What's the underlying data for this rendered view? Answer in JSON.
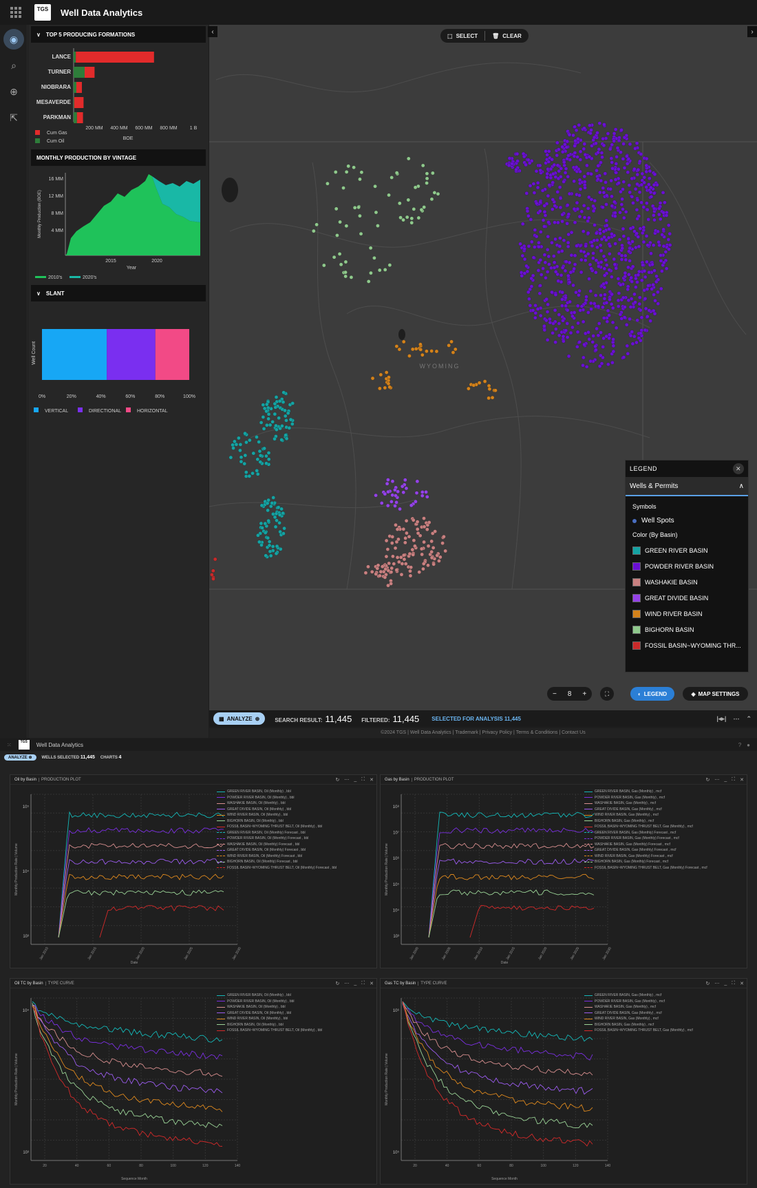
{
  "app": {
    "title": "Well Data Analytics",
    "logo_text": "TGS"
  },
  "rail": {
    "items": [
      "home",
      "search",
      "zoom-search",
      "export"
    ]
  },
  "panel": {
    "formations": {
      "title": "TOP 5 PRODUCING FORMATIONS",
      "chart_data": {
        "type": "bar",
        "categories": [
          "LANCE",
          "TURNER",
          "NIOBRARA",
          "MESAVERDE",
          "PARKMAN"
        ],
        "series": [
          {
            "name": "Cum Oil",
            "values": [
              20,
              100,
              25,
              5,
              30
            ]
          },
          {
            "name": "Cum Gas",
            "values": [
              710,
              90,
              50,
              85,
              55
            ]
          }
        ],
        "xlabel": "BOE",
        "tick_labels": [
          "200 MM",
          "400 MM",
          "600 MM",
          "800 MM",
          "1 B"
        ],
        "xlim": [
          0,
          1000
        ],
        "colors": {
          "Cum Gas": "#e22b2b",
          "Cum Oil": "#2e7d3a"
        }
      },
      "legend": [
        "Cum Gas",
        "Cum Oil"
      ]
    },
    "vintage": {
      "title": "MONTHLY PRODUCTION BY VINTAGE",
      "chart_data": {
        "type": "area",
        "ylabel": "Monthly Production (BOE)",
        "xlabel": "Year",
        "y_tick_labels": [
          "16 MM",
          "12 MM",
          "8 MM",
          "4 MM"
        ],
        "x_tick_labels": [
          "2015",
          "2020"
        ],
        "ylim": [
          0,
          18
        ],
        "series": [
          {
            "name": "2010's",
            "color": "#1fc25a"
          },
          {
            "name": "2020's",
            "color": "#19b8a6"
          }
        ]
      },
      "legend": [
        "2010's",
        "2020's"
      ]
    },
    "slant": {
      "title": "SLANT",
      "chart_data": {
        "type": "bar",
        "ylabel": "Well Count",
        "x_tick_labels": [
          "0%",
          "20%",
          "40%",
          "60%",
          "80%",
          "100%"
        ],
        "series": [
          {
            "name": "VERTICAL",
            "values": [
              44
            ],
            "color": "#17a7f5"
          },
          {
            "name": "DIRECTIONAL",
            "values": [
              33
            ],
            "color": "#7a2ff0"
          },
          {
            "name": "HORIZONTAL",
            "values": [
              23
            ],
            "color": "#f24a86"
          }
        ]
      },
      "legend": [
        "VERTICAL",
        "DIRECTIONAL",
        "HORIZONTAL"
      ]
    }
  },
  "map": {
    "toolbar": {
      "select": "SELECT",
      "clear": "CLEAR"
    },
    "state_label": "WYOMING",
    "zoom_level": "8",
    "legend": {
      "title": "LEGEND",
      "section": "Wells & Permits",
      "symbols_title": "Symbols",
      "symbol": "Well Spots",
      "color_title": "Color (By Basin)",
      "items": [
        {
          "label": "GREEN RIVER BASIN",
          "color": "#14a3a3"
        },
        {
          "label": "POWDER RIVER BASIN",
          "color": "#6a0fd4"
        },
        {
          "label": "WASHAKIE BASIN",
          "color": "#c98080"
        },
        {
          "label": "GREAT DIVIDE BASIN",
          "color": "#9442e8"
        },
        {
          "label": "WIND RIVER BASIN",
          "color": "#d4821a"
        },
        {
          "label": "BIGHORN BASIN",
          "color": "#8fc98c"
        },
        {
          "label": "FOSSIL BASIN~WYOMING THR...",
          "color": "#c92a2a"
        }
      ]
    },
    "buttons": {
      "legend": "LEGEND",
      "map_settings": "MAP SETTINGS"
    }
  },
  "status": {
    "analyze": "ANALYZE",
    "search_label": "SEARCH RESULT:",
    "search_value": "11,445",
    "filtered_label": "FILTERED:",
    "filtered_value": "11,445",
    "selected": "SELECTED FOR ANALYSIS 11,445"
  },
  "footer": "©2024 TGS | Well Data Analytics | Trademark | Privacy Policy | Terms & Conditions | Contact Us",
  "bottom": {
    "title": "Well Data Analytics",
    "analyze": "ANALYZE",
    "wells_selected_label": "WELLS SELECTED",
    "wells_selected": "11,445",
    "charts_label": "CHARTS",
    "charts": "4",
    "panels": [
      {
        "title": "Oil by Basin",
        "subtitle": "PRODUCTION PLOT",
        "xlabel": "Date",
        "ylabel": "Monthly Production Rate | Volume",
        "x_ticks": [
          "Jan 2010",
          "Jan 2015",
          "Jan 2020",
          "Jan 2025",
          "Jan 2030"
        ],
        "y_ticks": [
          "10⁵",
          "10⁴",
          "10³"
        ],
        "legend": [
          {
            "t": "GREEN RIVER BASIN, Oil (Monthly) , bbl",
            "c": "#14b8b8",
            "d": false
          },
          {
            "t": "POWDER RIVER BASIN, Oil (Monthly) , bbl",
            "c": "#7a2fe0",
            "d": false
          },
          {
            "t": "WASHAKIE BASIN, Oil (Monthly) , bbl",
            "c": "#d88f8f",
            "d": false
          },
          {
            "t": "GREAT DIVIDE BASIN, Oil (Monthly) , bbl",
            "c": "#9c5cf0",
            "d": false
          },
          {
            "t": "WIND RIVER BASIN, Oil (Monthly) , bbl",
            "c": "#e08a1e",
            "d": false
          },
          {
            "t": "BIGHORN BASIN, Oil (Monthly) , bbl",
            "c": "#9bd497",
            "d": false
          },
          {
            "t": "FOSSIL BASIN~WYOMING THRUST BELT, Oil (Monthly) , bbl",
            "c": "#d42a2a",
            "d": false
          },
          {
            "t": "GREEN RIVER BASIN, Oil (Monthly) Forecast , bbl",
            "c": "#14b8b8",
            "d": true
          },
          {
            "t": "POWDER RIVER BASIN, Oil (Monthly) Forecast , bbl",
            "c": "#7a2fe0",
            "d": true
          },
          {
            "t": "WASHAKIE BASIN, Oil (Monthly) Forecast , bbl",
            "c": "#d88f8f",
            "d": true
          },
          {
            "t": "GREAT DIVIDE BASIN, Oil (Monthly) Forecast , bbl",
            "c": "#9c5cf0",
            "d": true
          },
          {
            "t": "WIND RIVER BASIN, Oil (Monthly) Forecast , bbl",
            "c": "#e08a1e",
            "d": true
          },
          {
            "t": "BIGHORN BASIN, Oil (Monthly) Forecast , bbl",
            "c": "#9bd497",
            "d": true
          },
          {
            "t": "FOSSIL BASIN~WYOMING THRUST BELT, Oil (Monthly) Forecast , bbl",
            "c": "#d42a2a",
            "d": true
          }
        ]
      },
      {
        "title": "Gas by Basin",
        "subtitle": "PRODUCTION PLOT",
        "xlabel": "Date",
        "ylabel": "Monthly Production Rate | Volume",
        "x_ticks": [
          "Jan 2000",
          "Jan 2005",
          "Jan 2010",
          "Jan 2015",
          "Jan 2020",
          "Jan 2025",
          "Jan 2030"
        ],
        "y_ticks": [
          "10⁸",
          "10⁷",
          "10⁶",
          "10⁵",
          "10⁴",
          "10³"
        ],
        "legend": [
          {
            "t": "GREEN RIVER BASIN, Gas (Monthly) , mcf",
            "c": "#14b8b8",
            "d": false
          },
          {
            "t": "POWDER RIVER BASIN, Gas (Monthly) , mcf",
            "c": "#7a2fe0",
            "d": false
          },
          {
            "t": "WASHAKIE BASIN, Gas (Monthly) , mcf",
            "c": "#d88f8f",
            "d": false
          },
          {
            "t": "GREAT DIVIDE BASIN, Gas (Monthly) , mcf",
            "c": "#9c5cf0",
            "d": false
          },
          {
            "t": "WIND RIVER BASIN, Gas (Monthly) , mcf",
            "c": "#e08a1e",
            "d": false
          },
          {
            "t": "BIGHORN BASIN, Gas (Monthly) , mcf",
            "c": "#9bd497",
            "d": false
          },
          {
            "t": "FOSSIL BASIN~WYOMING THRUST BELT, Gas (Monthly) , mcf",
            "c": "#d42a2a",
            "d": false
          },
          {
            "t": "GREEN RIVER BASIN, Gas (Monthly) Forecast , mcf",
            "c": "#14b8b8",
            "d": true
          },
          {
            "t": "POWDER RIVER BASIN, Gas (Monthly) Forecast , mcf",
            "c": "#7a2fe0",
            "d": true
          },
          {
            "t": "WASHAKIE BASIN, Gas (Monthly) Forecast , mcf",
            "c": "#d88f8f",
            "d": true
          },
          {
            "t": "GREAT DIVIDE BASIN, Gas (Monthly) Forecast , mcf",
            "c": "#9c5cf0",
            "d": true
          },
          {
            "t": "WIND RIVER BASIN, Gas (Monthly) Forecast , mcf",
            "c": "#e08a1e",
            "d": true
          },
          {
            "t": "BIGHORN BASIN, Gas (Monthly) Forecast , mcf",
            "c": "#9bd497",
            "d": true
          },
          {
            "t": "FOSSIL BASIN~WYOMING THRUST BELT, Gas (Monthly) Forecast , mcf",
            "c": "#d42a2a",
            "d": true
          }
        ]
      },
      {
        "title": "Oil TC by Basin",
        "subtitle": "TYPE CURVE",
        "xlabel": "Sequence Month",
        "ylabel": "Monthly Production Rate | Volume",
        "x_ticks": [
          "20",
          "40",
          "60",
          "80",
          "100",
          "120",
          "140"
        ],
        "y_ticks": [
          "10⁴",
          "10³"
        ],
        "legend": [
          {
            "t": "GREEN RIVER BASIN, Oil (Monthly) , bbl",
            "c": "#14b8b8",
            "d": false
          },
          {
            "t": "POWDER RIVER BASIN, Oil (Monthly) , bbl",
            "c": "#7a2fe0",
            "d": false
          },
          {
            "t": "WASHAKIE BASIN, Oil (Monthly) , bbl",
            "c": "#d88f8f",
            "d": false
          },
          {
            "t": "GREAT DIVIDE BASIN, Oil (Monthly) , bbl",
            "c": "#9c5cf0",
            "d": false
          },
          {
            "t": "WIND RIVER BASIN, Oil (Monthly) , bbl",
            "c": "#e08a1e",
            "d": false
          },
          {
            "t": "BIGHORN BASIN, Oil (Monthly) , bbl",
            "c": "#9bd497",
            "d": false
          },
          {
            "t": "FOSSIL BASIN~WYOMING THRUST BELT, Oil (Monthly) , bbl",
            "c": "#d42a2a",
            "d": false
          }
        ]
      },
      {
        "title": "Gas TC by Basin",
        "subtitle": "TYPE CURVE",
        "xlabel": "Sequence Month",
        "ylabel": "Monthly Production Rate | Volume",
        "x_ticks": [
          "20",
          "40",
          "60",
          "80",
          "100",
          "120",
          "140"
        ],
        "y_ticks": [
          "10⁶",
          "10⁵"
        ],
        "legend": [
          {
            "t": "GREEN RIVER BASIN, Gas (Monthly) , mcf",
            "c": "#14b8b8",
            "d": false
          },
          {
            "t": "POWDER RIVER BASIN, Gas (Monthly) , mcf",
            "c": "#7a2fe0",
            "d": false
          },
          {
            "t": "WASHAKIE BASIN, Gas (Monthly) , mcf",
            "c": "#d88f8f",
            "d": false
          },
          {
            "t": "GREAT DIVIDE BASIN, Gas (Monthly) , mcf",
            "c": "#9c5cf0",
            "d": false
          },
          {
            "t": "WIND RIVER BASIN, Gas (Monthly) , mcf",
            "c": "#e08a1e",
            "d": false
          },
          {
            "t": "BIGHORN BASIN, Gas (Monthly) , mcf",
            "c": "#9bd497",
            "d": false
          },
          {
            "t": "FOSSIL BASIN~WYOMING THRUST BELT, Gas (Monthly) , mcf",
            "c": "#d42a2a",
            "d": false
          }
        ]
      }
    ]
  }
}
